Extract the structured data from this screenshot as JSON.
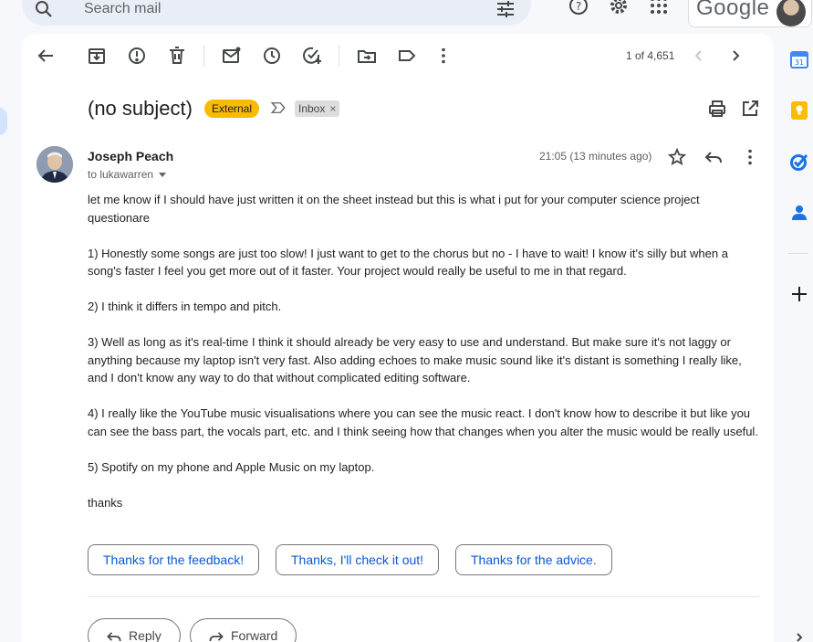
{
  "search": {
    "placeholder": "Search mail"
  },
  "header": {
    "brand": "Google"
  },
  "toolbar": {
    "pager": "1 of 4,651"
  },
  "email": {
    "subject": "(no subject)",
    "labels": {
      "external": "External",
      "inbox": "Inbox",
      "remove": "×"
    },
    "sender": "Joseph Peach",
    "to": "to lukawarren",
    "date": "21:05 (13 minutes ago)",
    "body": [
      "let me know if I should have just written it on the sheet instead but this is what i put for your computer science project questionare",
      "1) Honestly some songs are just too slow! I just want to get to the chorus but no - I have to wait! I know it's silly but when a song's faster I feel you get more out of it faster. Your project would really be useful to me in that regard.",
      "2) I think it differs in tempo and pitch.",
      "3) Well as long as it's real-time I think it should already be very easy to use and understand. But make sure it's not laggy or anything because my laptop isn't very fast. Also adding echoes to make music sound like it's distant is something I really like, and I don't know any way to do that without complicated editing software.",
      "4) I really like the YouTube music visualisations where you can see the music react. I don't know how to describe it but like you can see the bass part, the vocals part, etc. and I think seeing how that changes when you alter the music would be really useful.",
      "5) Spotify on my phone and Apple Music on my laptop.",
      "thanks"
    ]
  },
  "smart_replies": [
    "Thanks for the feedback!",
    "Thanks, I'll check it out!",
    "Thanks for the advice."
  ],
  "actions": {
    "reply": "Reply",
    "forward": "Forward"
  },
  "colors": {
    "external_badge": "#f9ba00",
    "link_blue": "#0b57d0",
    "background": "#f6f8fc"
  }
}
